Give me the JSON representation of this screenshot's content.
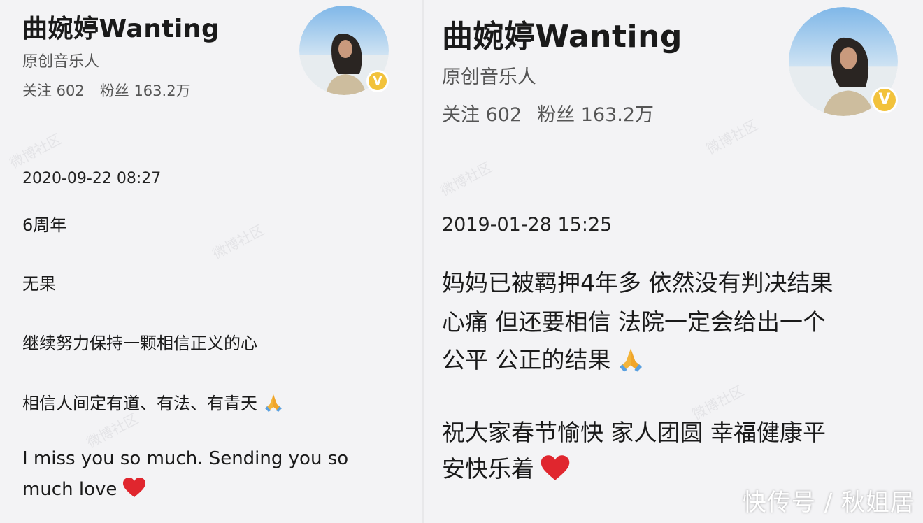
{
  "left": {
    "name": "曲婉婷Wanting",
    "role": "原创音乐人",
    "follow_label": "关注 602",
    "fans_label": "粉丝 163.2万",
    "timestamp": "2020-09-22 08:27",
    "lines": [
      "6周年",
      "无果",
      "继续努力保持一颗相信正义的心",
      "相信人间定有道、有法、有青天",
      "I miss you so much. Sending you so",
      "much love"
    ]
  },
  "right": {
    "name": "曲婉婷Wanting",
    "role": "原创音乐人",
    "follow_label": "关注 602",
    "fans_label": "粉丝 163.2万",
    "timestamp": "2019-01-28 15:25",
    "lines": [
      "妈妈已被羁押4年多 依然没有判决结果",
      "心痛 但还要相信 法院一定会给出一个",
      "公平 公正的结果",
      "祝大家春节愉快 家人团圆 幸福健康平",
      "安快乐着"
    ]
  },
  "watermark": "快传号 / 秋姐居",
  "icons": {
    "pray": "folded-hands-emoji",
    "heart": "red-heart-emoji",
    "badge": "verified-v-badge"
  },
  "colors": {
    "badge": "#f2c23b",
    "heart": "#e0262e",
    "pray": "#f3b43a"
  }
}
